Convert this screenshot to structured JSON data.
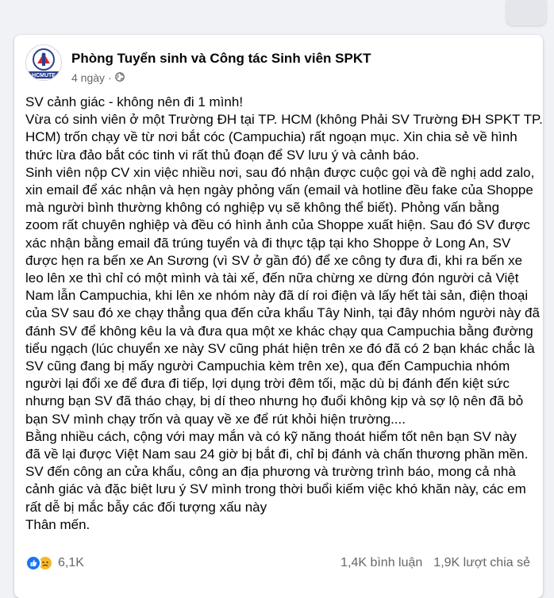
{
  "post": {
    "page_name": "Phòng Tuyển sinh và Công tác Sinh viên SPKT",
    "avatar_caption": "HCMUTE",
    "timestamp": "4 ngày",
    "audience_icon": "globe-icon",
    "body_lines": [
      "SV cảnh giác - không nên đi 1 mình!",
      "Vừa có sinh viên ở một Trường ĐH tại TP. HCM (không Phải SV Trường ĐH SPKT TP.",
      "HCM) trốn chạy về từ nơi bắt cóc (Campuchia) rất ngoạn mục. Xin chia sẻ về hình",
      "thức lừa đảo bắt cóc tinh vi rất thủ đoạn để SV lưu ý và cảnh báo.",
      "Sinh viên nộp CV xin việc nhiều nơi, sau đó nhận được cuộc gọi và đề nghị add zalo,",
      "xin email để xác nhận và hẹn ngày phỏng vấn (email và hotline đều fake của Shoppe",
      "mà người bình thường không có nghiệp vụ sẽ không thể biết). Phỏng vấn bằng",
      "zoom rất chuyên nghiệp và đều có hình ảnh của Shoppe xuất hiện. Sau đó SV được",
      "xác nhận bằng email đã trúng tuyển và đi thực tập tại kho Shoppe ở Long An, SV",
      "được hẹn ra bến xe An Sương (vì SV ở gần đó) để xe công ty đưa đi, khi ra bến xe",
      "leo lên xe thì chỉ có một mình và tài xế, đến nữa chừng xe dừng đón người cả Việt",
      "Nam lẫn Campuchia, khi lên xe nhóm này đã dí roi điện và lấy hết tài sản, điện thoại",
      "của SV sau đó xe chạy thẳng qua đến cửa khẩu Tây Ninh, tại đây nhóm người này đã",
      "đánh SV để không kêu la và đưa qua một xe khác chạy qua Campuchia bằng đường",
      "tiểu ngạch (lúc chuyển xe này SV cũng phát hiện trên xe đó đã có 2 bạn khác chắc là",
      "SV cũng đang bị mấy người Campuchia kèm trên xe), qua đến Campuchia nhóm",
      "người lại đổi xe để đưa đi tiếp, lợi dụng trời đêm tối, mặc dù bị đánh đến kiệt sức",
      "nhưng bạn SV đã tháo chạy, bị dí theo nhưng họ đuổi không kịp và sợ lộ  nên đã bỏ",
      "bạn SV mình chạy trốn và quay về xe để rút khỏi hiện trường....",
      "Bằng nhiều cách, cộng với may mắn và có kỹ năng thoát hiểm tốt nên bạn SV này",
      "đã về lại được Việt Nam sau 24 giờ bị bắt đi, chỉ bị đánh và chấn thương phần mền.",
      "SV đến công an cửa khẩu, công an địa phương và trường trình báo, mong cả nhà",
      "cảnh giác và đặc biệt lưu ý SV mình trong thời buổi kiếm việc khó khăn này, các em",
      "rất dễ bị mắc bẫy các đối tượng xấu này",
      "Thân mến."
    ]
  },
  "footer": {
    "reaction_icons": [
      "like-icon",
      "sad-icon"
    ],
    "reaction_count": "6,1K",
    "comments_count": "1,4K bình luận",
    "shares_count": "1,9K lượt chia sẻ"
  },
  "colors": {
    "background": "#f0f2f5",
    "card": "#ffffff",
    "text_primary": "#050505",
    "text_secondary": "#65676b",
    "like_blue": "#1877f2",
    "sad_yellow": "#f7b928",
    "logo_red": "#d7252d",
    "logo_blue": "#2a3f8f"
  }
}
